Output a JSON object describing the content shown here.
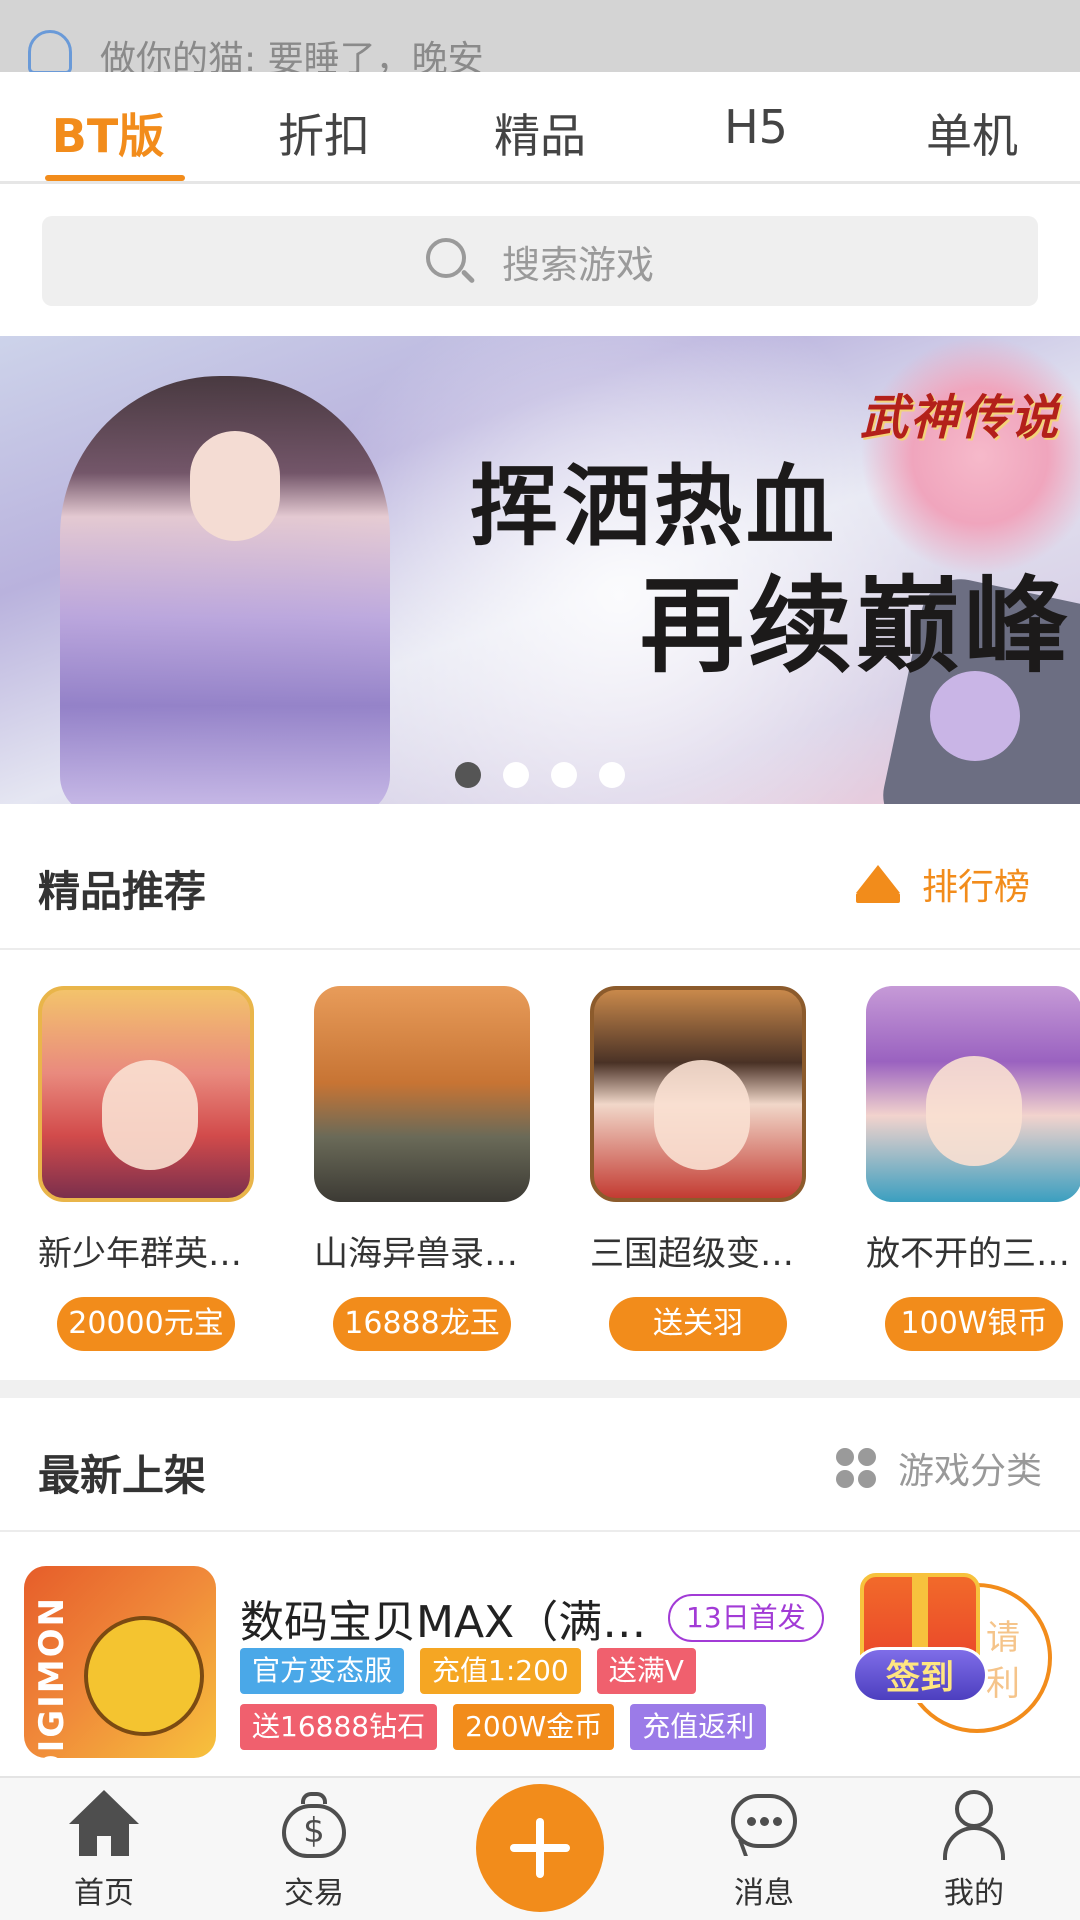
{
  "notification": {
    "text": "做你的猫: 要睡了，晚安"
  },
  "tabs": [
    {
      "label": "BT版",
      "active": true
    },
    {
      "label": "折扣"
    },
    {
      "label": "精品"
    },
    {
      "label": "H5"
    },
    {
      "label": "单机"
    }
  ],
  "search": {
    "placeholder": "搜索游戏",
    "icon": "search-icon"
  },
  "banner": {
    "logo": "武神传说",
    "slogan_line1": "挥洒热血",
    "slogan_line2": "再续巅峰",
    "dots_total": 4,
    "active_dot": 1
  },
  "featured": {
    "title": "精品推荐",
    "more_label": "排行榜",
    "more_icon": "crown-icon",
    "games": [
      {
        "name": "新少年群英…",
        "badge": "20000元宝"
      },
      {
        "name": "山海异兽录…",
        "badge": "16888龙玉"
      },
      {
        "name": "三国超级变…",
        "badge": "送关羽"
      },
      {
        "name": "放不开的三…",
        "badge": "100W银币"
      }
    ]
  },
  "latest": {
    "title": "最新上架",
    "more_label": "游戏分类",
    "more_icon": "grid-icon",
    "item": {
      "icon_text": "DIGIMON",
      "name": "数码宝贝MAX（满…",
      "release_badge": "13日首发",
      "tags_row1": [
        {
          "text": "官方变态服",
          "color": "#4aa8e8"
        },
        {
          "text": "充值1:200",
          "color": "#f5a623"
        },
        {
          "text": "送满V",
          "color": "#f0606e"
        }
      ],
      "tags_row2": [
        {
          "text": "送16888钻石",
          "color": "#f0606e"
        },
        {
          "text": "200W金币",
          "color": "#f28c1b"
        },
        {
          "text": "充值返利",
          "color": "#9b7be8"
        }
      ]
    }
  },
  "signin": {
    "label": "签到",
    "ring_text": "请利"
  },
  "bottom_nav": [
    {
      "label": "首页",
      "icon": "home-icon"
    },
    {
      "label": "交易",
      "icon": "money-bag-icon"
    },
    {
      "label": "消息",
      "icon": "chat-icon"
    },
    {
      "label": "我的",
      "icon": "user-icon"
    }
  ],
  "colors": {
    "accent": "#f28c1b",
    "text": "#333333",
    "divider": "#ececec"
  }
}
